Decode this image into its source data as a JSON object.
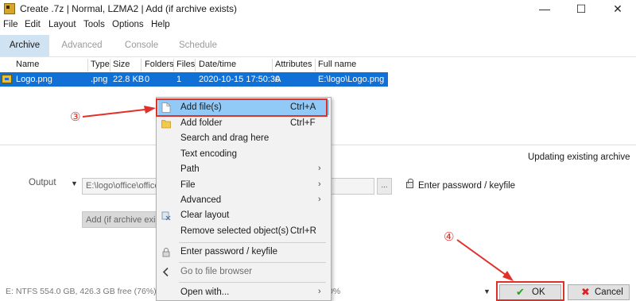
{
  "window": {
    "title": "Create .7z | Normal, LZMA2 | Add (if archive exists)",
    "minimize_glyph": "—",
    "maximize_glyph": "☐",
    "close_glyph": "✕"
  },
  "menubar": {
    "items": [
      "File",
      "Edit",
      "Layout",
      "Tools",
      "Options",
      "Help"
    ]
  },
  "tabs": [
    {
      "label": "Archive",
      "active": true
    },
    {
      "label": "Advanced",
      "active": false
    },
    {
      "label": "Console",
      "active": false
    },
    {
      "label": "Schedule",
      "active": false
    }
  ],
  "file_list": {
    "columns": [
      "Name",
      "Type",
      "Size",
      "Folders",
      "Files",
      "Date/time",
      "Attributes",
      "Full name"
    ],
    "rows": [
      {
        "name": "Logo.png",
        "type": ".png",
        "size": "22.8 KB",
        "folders": "0",
        "files": "1",
        "datetime": "2020-10-15 17:50:30",
        "attributes": "A",
        "full_name": "E:\\logo\\Logo.png"
      }
    ]
  },
  "main": {
    "updating_text": "Updating existing archive",
    "output_label": "Output",
    "output_value": "E:\\logo\\office\\office",
    "browse_label": "...",
    "password_label": "Enter password / keyfile",
    "update_mode": "Add (if archive exists)"
  },
  "context_menu": {
    "items": [
      {
        "label": "Add file(s)",
        "shortcut": "Ctrl+A",
        "icon": "file-icon",
        "highlighted": true
      },
      {
        "label": "Add folder",
        "shortcut": "Ctrl+F",
        "icon": "folder-icon"
      },
      {
        "label": "Search and drag here",
        "shortcut": ""
      },
      {
        "label": "Text encoding",
        "shortcut": ""
      },
      {
        "label": "Path",
        "shortcut": "",
        "submenu": true
      },
      {
        "label": "File",
        "shortcut": "",
        "submenu": true
      },
      {
        "label": "Advanced",
        "shortcut": "",
        "submenu": true
      },
      {
        "label": "Clear layout",
        "shortcut": "",
        "icon": "clear-layout-icon"
      },
      {
        "label": "Remove selected object(s)",
        "shortcut": "Ctrl+R"
      },
      {
        "label": "Enter password / keyfile",
        "shortcut": "",
        "icon": "lock-icon"
      },
      {
        "label": "Go to file browser",
        "shortcut": "",
        "icon": "back-arrow-icon",
        "dimmed": true
      },
      {
        "label": "Open with...",
        "shortcut": "",
        "submenu": true
      }
    ],
    "submenu_glyph": "›"
  },
  "status": {
    "disk": "E: NTFS 554.0 GB, 426.3 GB free (76%)",
    "percent": "0%"
  },
  "buttons": {
    "ok": "OK",
    "cancel": "Cancel",
    "ok_glyph": "✔",
    "cancel_glyph": "✖"
  },
  "annotations": {
    "badge_3": "③",
    "badge_4": "④",
    "color": "#e0302a"
  },
  "colors": {
    "selection": "#1070d6",
    "active_tab": "#cfe3f3",
    "menu_highlight": "#91c9f7"
  }
}
